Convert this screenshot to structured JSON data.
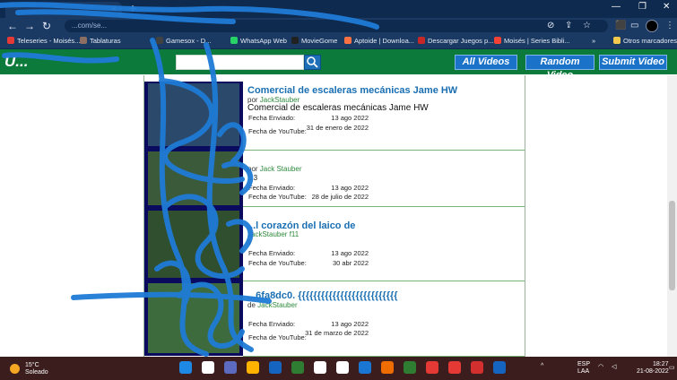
{
  "browser": {
    "tab": {
      "close": "×"
    },
    "new_tab": "+",
    "window_controls": [
      "—",
      "❐",
      "✕"
    ],
    "nav": {
      "back": "←",
      "forward": "→",
      "reload": "↻"
    },
    "address_text": "...com/se...",
    "toolbar_icons": [
      "⊘",
      "⇪",
      "☆",
      "⬛",
      "▭",
      "⋮"
    ]
  },
  "bookmarks": {
    "items": [
      {
        "label": "Teleseries - Moisés...",
        "color": "#e53935"
      },
      {
        "label": "Tablaturas",
        "color": "#8d6e63"
      },
      {
        "label": "Gamesox - D...",
        "color": "#424242"
      },
      {
        "label": "WhatsApp Web",
        "color": "#25d366"
      },
      {
        "label": "MovieGome",
        "color": "#212121"
      },
      {
        "label": "Aptoide | Downloa...",
        "color": "#ff7043"
      },
      {
        "label": "Descargar Juegos p...",
        "color": "#c62828"
      },
      {
        "label": "Moisés | Series Bibli...",
        "color": "#f44336"
      }
    ],
    "more": "»",
    "other": "Otros marcadores"
  },
  "site": {
    "logo": "U...",
    "search_placeholder": "",
    "search_icon": "magnifier-icon",
    "nav": [
      "All Videos",
      "Random Video",
      "Submit Video"
    ]
  },
  "videos": [
    {
      "title": "Comercial de escaleras mecánicas Jame HW",
      "by_prefix": "por",
      "author": "JackStauber",
      "extra": "",
      "desc": "Comercial de escaleras mecánicas Jame HW",
      "sent_label": "Fecha Enviado:",
      "sent": "13 ago 2022",
      "yt_label": "Fecha de YouTube:",
      "yt": "31 de enero de 2022"
    },
    {
      "title": "",
      "by_prefix": "por",
      "author": "Jack Stauber",
      "extra": "",
      "desc": "...3",
      "sent_label": "Fecha Enviado:",
      "sent": "13 ago 2022",
      "yt_label": "Fecha de YouTube:",
      "yt": "28 de julio de 2022"
    },
    {
      "title": "...l corazón del laico de",
      "by_prefix": "",
      "author": "JackStauber",
      "extra": "f11",
      "desc": "V",
      "sent_label": "Fecha Enviado:",
      "sent": "13 ago 2022",
      "yt_label": "Fecha de YouTube:",
      "yt": "30 abr 2022"
    },
    {
      "title": "...6fa8dc0. {{{{{{{{{{{{{{{{{{{{{{{{{{",
      "by_prefix": "de",
      "author": "JackStauber",
      "extra": "",
      "desc": "",
      "sent_label": "Fecha Enviado:",
      "sent": "13 ago 2022",
      "yt_label": "Fecha de YouTube:",
      "yt": "31 de marzo de 2022"
    }
  ],
  "taskbar": {
    "temp": "15°C",
    "weather": "Soleado",
    "lang": "ESP",
    "layout": "LAA",
    "time": "18:27",
    "date": "21-08-2022",
    "app_colors": [
      "#1e88e5",
      "#ffffff",
      "#5c6bc0",
      "#ffb300",
      "#1565c0",
      "#2e7d32",
      "#ffffff",
      "#ffffff",
      "#1976d2",
      "#ef6c00",
      "#2e7d32",
      "#e53935",
      "#e53935",
      "#d32f2f",
      "#1565c0",
      "#ffffff"
    ]
  },
  "colors": {
    "site_green": "#0b7a3b",
    "link_blue": "#1a6fb3",
    "author_green": "#2d8a3c",
    "scribble": "#1f7bd6"
  }
}
